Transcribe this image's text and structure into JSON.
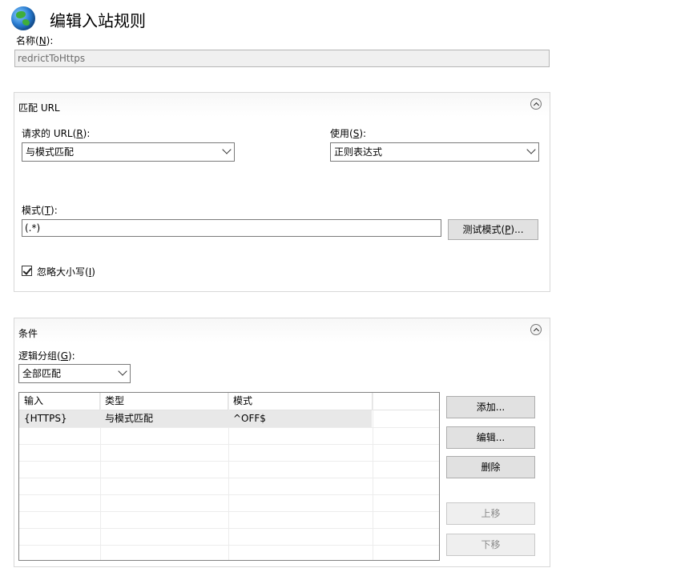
{
  "header": {
    "title": "编辑入站规则"
  },
  "name_field": {
    "label": "名称(",
    "accel": "N",
    "label_end": "):",
    "value": "redrictToHttps"
  },
  "match_url": {
    "title": "匹配 URL",
    "requested_url": {
      "label": "请求的 URL(",
      "accel": "R",
      "label_end": "):",
      "value": "与模式匹配"
    },
    "using": {
      "label": "使用(",
      "accel": "S",
      "label_end": "):",
      "value": "正则表达式"
    },
    "pattern": {
      "label": "模式(",
      "accel": "T",
      "label_end": "):",
      "value": "(.*)"
    },
    "test_button": {
      "label": "测试模式(",
      "accel": "P",
      "label_end": ")..."
    },
    "ignore_case": {
      "label": "忽略大小写(",
      "accel": "I",
      "label_end": ")",
      "checked": true
    }
  },
  "conditions": {
    "title": "条件",
    "logical_grouping": {
      "label": "逻辑分组(",
      "accel": "G",
      "label_end": "):",
      "value": "全部匹配"
    },
    "columns": [
      "输入",
      "类型",
      "模式"
    ],
    "rows": [
      {
        "input": "{HTTPS}",
        "type": "与模式匹配",
        "pattern": "^OFF$"
      }
    ],
    "buttons": {
      "add": "添加...",
      "edit": "编辑...",
      "remove": "删除",
      "move_up": "上移",
      "move_down": "下移"
    }
  }
}
